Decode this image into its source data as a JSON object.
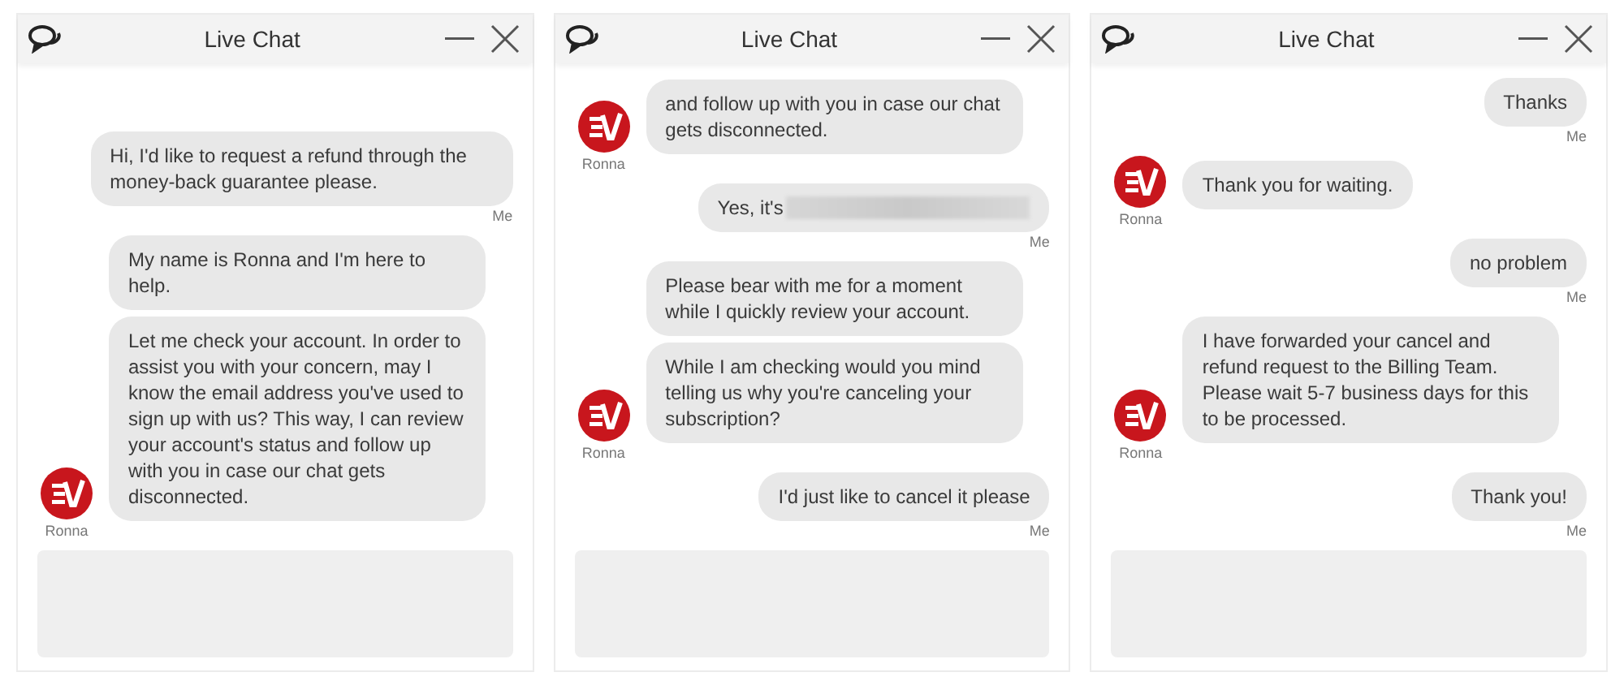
{
  "windows": [
    {
      "title": "Live Chat",
      "messages": [
        {
          "kind": "me",
          "label": "Me",
          "bubbles": [
            {
              "text": "Hi, I'd like to request a refund through the money-back guarantee please."
            }
          ]
        },
        {
          "kind": "agent",
          "label": "Ronna",
          "bubbles": [
            {
              "text": "My name is Ronna and I'm here to help."
            },
            {
              "text": "Let me check your account. In order to assist you with your concern, may I know the email address you've used to sign up with us? This way, I can review your account's status and follow up with you in case our chat gets disconnected."
            }
          ]
        }
      ]
    },
    {
      "title": "Live Chat",
      "messages": [
        {
          "kind": "agent",
          "label": "Ronna",
          "bubbles": [
            {
              "text": "and follow up with you in case our chat gets disconnected."
            }
          ]
        },
        {
          "kind": "me",
          "label": "Me",
          "bubbles": [
            {
              "text": "Yes, it's",
              "redacted": true
            }
          ]
        },
        {
          "kind": "agent",
          "label": "Ronna",
          "bubbles": [
            {
              "text": "Please bear with me for a moment while I quickly review your account."
            },
            {
              "text": "While I am checking would you mind telling us why you're canceling your subscription?"
            }
          ]
        },
        {
          "kind": "me",
          "label": "Me",
          "bubbles": [
            {
              "text": "I'd just like to cancel it please"
            }
          ]
        }
      ]
    },
    {
      "title": "Live Chat",
      "messages": [
        {
          "kind": "me",
          "label": "Me",
          "bubbles": [
            {
              "text": "Thanks"
            }
          ]
        },
        {
          "kind": "agent",
          "label": "Ronna",
          "bubbles": [
            {
              "text": "Thank you for waiting."
            }
          ]
        },
        {
          "kind": "me",
          "label": "Me",
          "bubbles": [
            {
              "text": "no problem"
            }
          ]
        },
        {
          "kind": "agent",
          "label": "Ronna",
          "bubbles": [
            {
              "text": "I have forwarded your cancel and refund request to the Billing Team. Please wait 5-7 business days for this to be processed."
            }
          ]
        },
        {
          "kind": "me",
          "label": "Me",
          "bubbles": [
            {
              "text": "Thank you!"
            }
          ]
        }
      ]
    }
  ]
}
